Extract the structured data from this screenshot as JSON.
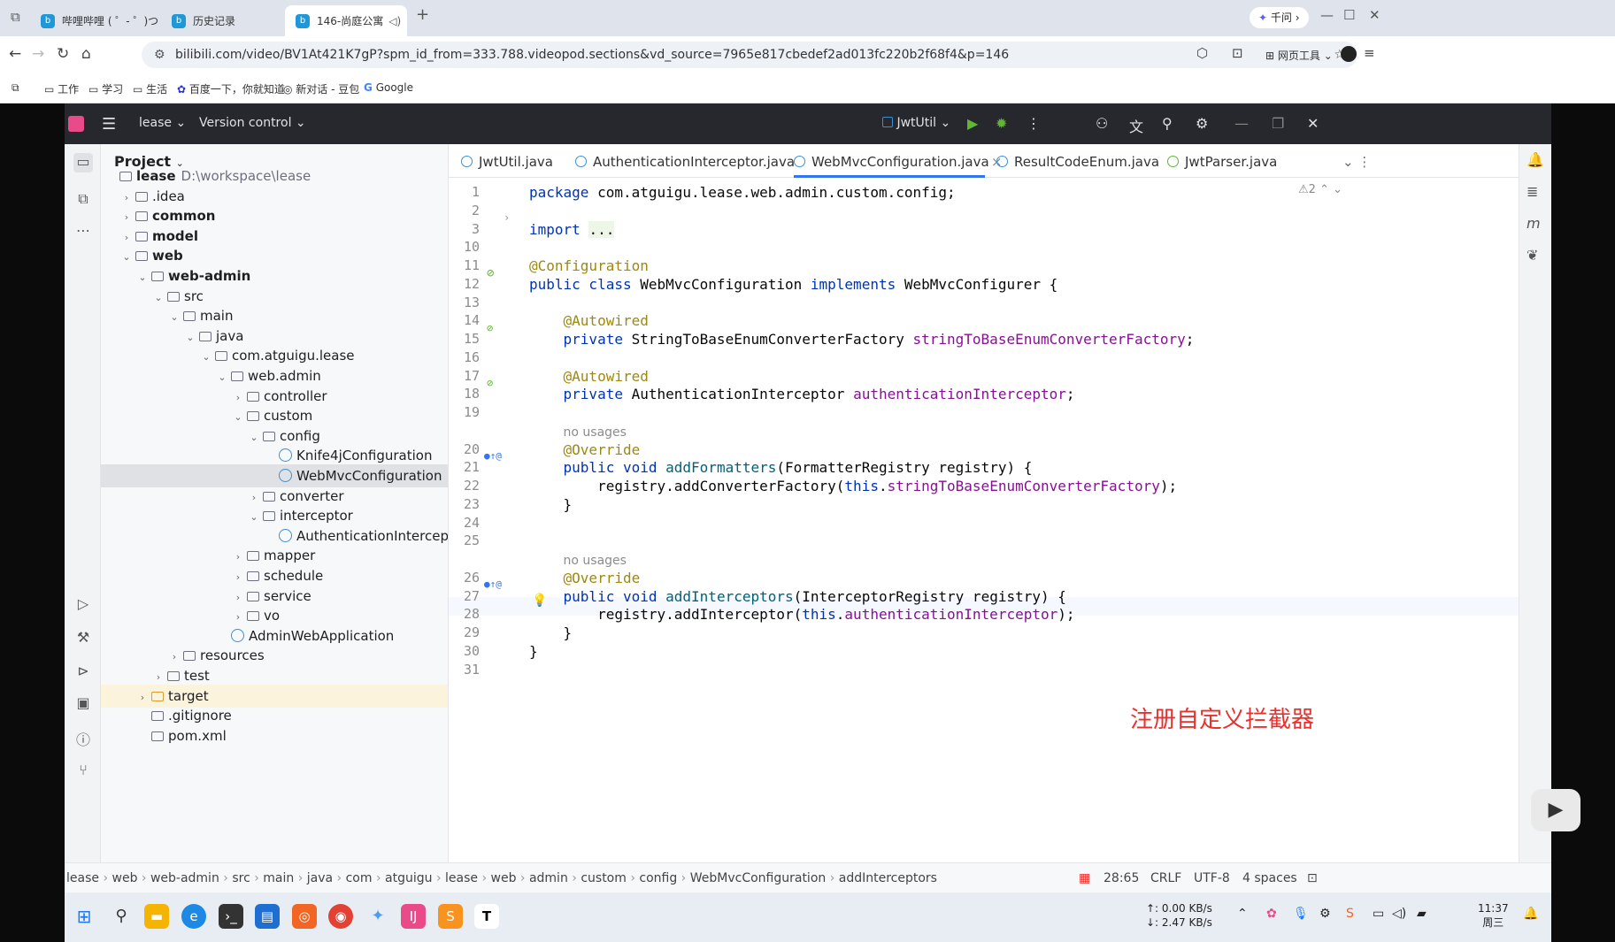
{
  "browser": {
    "tabs": [
      {
        "title": "哔哩哔哩 ( ゜- ゜)つロ"
      },
      {
        "title": "历史记录"
      },
      {
        "title": "146-尚庭公寓"
      }
    ],
    "qianwen_label": "千问",
    "url": "bilibili.com/video/BV1At421K7gP?spm_id_from=333.788.videopod.sections&vd_source=7965e817cbedef2ad013fc220b2f68f4&p=146",
    "web_tools_label": "网页工具",
    "bookmarks": [
      "工作",
      "学习",
      "生活",
      "百度一下，你就知道",
      "新对话 - 豆包",
      "Google"
    ]
  },
  "ide": {
    "project_name": "lease",
    "vcs_label": "Version control",
    "run_config": "JwtUtil",
    "panel_title": "Project",
    "tree": [
      {
        "label": "lease",
        "extra": "D:\\workspace\\lease",
        "depth": 0,
        "arrow": "",
        "bold": true
      },
      {
        "label": ".idea",
        "depth": 1,
        "arrow": "›"
      },
      {
        "label": "common",
        "depth": 1,
        "arrow": "›",
        "bold": true
      },
      {
        "label": "model",
        "depth": 1,
        "arrow": "›",
        "bold": true
      },
      {
        "label": "web",
        "depth": 1,
        "arrow": "⌄",
        "bold": true
      },
      {
        "label": "web-admin",
        "depth": 2,
        "arrow": "⌄",
        "bold": true
      },
      {
        "label": "src",
        "depth": 3,
        "arrow": "⌄"
      },
      {
        "label": "main",
        "depth": 4,
        "arrow": "⌄"
      },
      {
        "label": "java",
        "depth": 5,
        "arrow": "⌄"
      },
      {
        "label": "com.atguigu.lease",
        "depth": 6,
        "arrow": "⌄"
      },
      {
        "label": "web.admin",
        "depth": 7,
        "arrow": "⌄"
      },
      {
        "label": "controller",
        "depth": 8,
        "arrow": "›"
      },
      {
        "label": "custom",
        "depth": 8,
        "arrow": "⌄"
      },
      {
        "label": "config",
        "depth": 9,
        "arrow": "⌄"
      },
      {
        "label": "Knife4jConfiguration",
        "depth": 10,
        "arrow": "",
        "cls": true
      },
      {
        "label": "WebMvcConfiguration",
        "depth": 10,
        "arrow": "",
        "cls": true,
        "selected": true
      },
      {
        "label": "converter",
        "depth": 9,
        "arrow": "›"
      },
      {
        "label": "interceptor",
        "depth": 9,
        "arrow": "⌄"
      },
      {
        "label": "AuthenticationIntercep",
        "depth": 10,
        "arrow": "",
        "cls": true
      },
      {
        "label": "mapper",
        "depth": 8,
        "arrow": "›"
      },
      {
        "label": "schedule",
        "depth": 8,
        "arrow": "›"
      },
      {
        "label": "service",
        "depth": 8,
        "arrow": "›"
      },
      {
        "label": "vo",
        "depth": 8,
        "arrow": "›"
      },
      {
        "label": "AdminWebApplication",
        "depth": 7,
        "arrow": "",
        "cls": true
      },
      {
        "label": "resources",
        "depth": 4,
        "arrow": "›"
      },
      {
        "label": "test",
        "depth": 3,
        "arrow": "›"
      },
      {
        "label": "target",
        "depth": 2,
        "arrow": "›",
        "target": true
      },
      {
        "label": ".gitignore",
        "depth": 2,
        "arrow": ""
      },
      {
        "label": "pom.xml",
        "depth": 2,
        "arrow": ""
      }
    ],
    "editor_tabs": [
      "JwtUtil.java",
      "AuthenticationInterceptor.java",
      "WebMvcConfiguration.java",
      "ResultCodeEnum.java",
      "JwtParser.java"
    ],
    "warnings": "⚠2",
    "code": [
      {
        "n": "1",
        "html": "<span class='kw'>package</span> com.atguigu.lease.web.admin.custom.config;"
      },
      {
        "n": "2",
        "html": ""
      },
      {
        "n": "3",
        "html": "<span class='kw'>import</span> <span style='background:#eef6e8'>...</span>"
      },
      {
        "n": "10",
        "html": ""
      },
      {
        "n": "11",
        "html": "<span class='an'>@Configuration</span>"
      },
      {
        "n": "12",
        "html": "<span class='kw'>public class</span> WebMvcConfiguration <span class='kw'>implements</span> WebMvcConfigurer {"
      },
      {
        "n": "13",
        "html": ""
      },
      {
        "n": "14",
        "html": "    <span class='an'>@Autowired</span>"
      },
      {
        "n": "15",
        "html": "    <span class='kw'>private</span> StringToBaseEnumConverterFactory <span class='fld'>stringToBaseEnumConverterFactory</span>;"
      },
      {
        "n": "16",
        "html": ""
      },
      {
        "n": "17",
        "html": "    <span class='an'>@Autowired</span>"
      },
      {
        "n": "18",
        "html": "    <span class='kw'>private</span> AuthenticationInterceptor <span class='fld'>authenticationInterceptor</span>;"
      },
      {
        "n": "19",
        "html": ""
      },
      {
        "n": "",
        "html": "    <span class='hint'>no usages</span>"
      },
      {
        "n": "20",
        "html": "    <span class='an'>@Override</span>"
      },
      {
        "n": "21",
        "html": "    <span class='kw'>public void</span> <span class='mth'>addFormatters</span>(FormatterRegistry registry) {"
      },
      {
        "n": "22",
        "html": "        registry.addConverterFactory(<span class='kw'>this</span>.<span class='fld'>stringToBaseEnumConverterFactory</span>);"
      },
      {
        "n": "23",
        "html": "    }"
      },
      {
        "n": "24",
        "html": ""
      },
      {
        "n": "25",
        "html": ""
      },
      {
        "n": "",
        "html": "    <span class='hint'>no usages</span>"
      },
      {
        "n": "26",
        "html": "    <span class='an'>@Override</span>"
      },
      {
        "n": "27",
        "html": "    <span class='kw'>public void</span> <span class='mth'>addInterceptors</span>(InterceptorRegistry registry) {"
      },
      {
        "n": "28",
        "html": "        registry.addInterceptor(<span class='kw'>this</span>.<span class='fld'>authenticationInterceptor</span>);"
      },
      {
        "n": "29",
        "html": "    }"
      },
      {
        "n": "30",
        "html": "}"
      },
      {
        "n": "31",
        "html": ""
      }
    ],
    "annotation": "注册自定义拦截器",
    "breadcrumb": [
      "lease",
      "web",
      "web-admin",
      "src",
      "main",
      "java",
      "com",
      "atguigu",
      "lease",
      "web",
      "admin",
      "custom",
      "config",
      "WebMvcConfiguration",
      "addInterceptors"
    ],
    "status": {
      "position": "28:65",
      "line_sep": "CRLF",
      "encoding": "UTF-8",
      "indent": "4 spaces"
    }
  },
  "taskbar": {
    "net_up": "↑: 0.00 KB/s",
    "net_down": "↓: 2.47 KB/s",
    "time": "11:37",
    "day": "周三"
  }
}
